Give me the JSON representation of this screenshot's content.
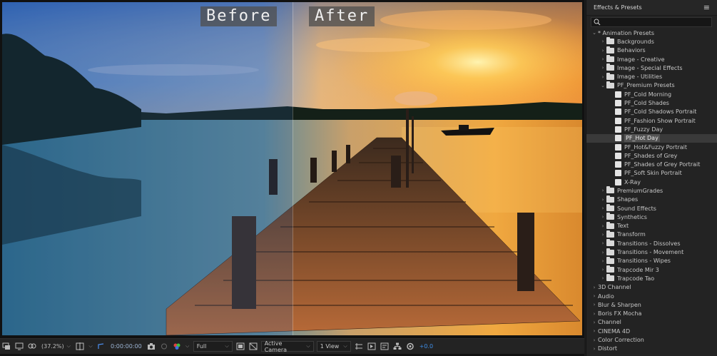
{
  "viewer": {
    "before_label": "Before",
    "after_label": "After"
  },
  "toolbar": {
    "zoom": "(37.2%)",
    "timecode": "0:00:00:00",
    "resolution": "Full",
    "camera": "Active Camera",
    "views": "1 View",
    "exposure": "+0.0",
    "colors": {
      "exposure": "#3e8ee8"
    }
  },
  "panel": {
    "title": "Effects & Presets",
    "menu_icon": "hamburger-menu-icon",
    "search_value": "",
    "items": [
      {
        "label": "* Animation Presets",
        "depth": 0,
        "type": "group",
        "open": true
      },
      {
        "label": "Backgrounds",
        "depth": 1,
        "type": "folder",
        "open": false
      },
      {
        "label": "Behaviors",
        "depth": 1,
        "type": "folder",
        "open": false
      },
      {
        "label": "Image - Creative",
        "depth": 1,
        "type": "folder",
        "open": false
      },
      {
        "label": "Image - Special Effects",
        "depth": 1,
        "type": "folder",
        "open": false
      },
      {
        "label": "Image - Utilities",
        "depth": 1,
        "type": "folder",
        "open": false
      },
      {
        "label": "PF_Premium Presets",
        "depth": 1,
        "type": "folder",
        "open": true
      },
      {
        "label": "PF_Cold Morning",
        "depth": 2,
        "type": "preset"
      },
      {
        "label": "PF_Cold Shades",
        "depth": 2,
        "type": "preset"
      },
      {
        "label": "PF_Cold Shadows Portrait",
        "depth": 2,
        "type": "preset"
      },
      {
        "label": "PF_Fashion Show Portrait",
        "depth": 2,
        "type": "preset"
      },
      {
        "label": "PF_Fuzzy Day",
        "depth": 2,
        "type": "preset"
      },
      {
        "label": "PF_Hot Day",
        "depth": 2,
        "type": "preset",
        "selected": true
      },
      {
        "label": "PF_Hot&Fuzzy Portrait",
        "depth": 2,
        "type": "preset"
      },
      {
        "label": "PF_Shades of Grey",
        "depth": 2,
        "type": "preset"
      },
      {
        "label": "PF_Shades of Grey Portrait",
        "depth": 2,
        "type": "preset"
      },
      {
        "label": "PF_Soft Skin Portrait",
        "depth": 2,
        "type": "preset"
      },
      {
        "label": "X-Ray",
        "depth": 2,
        "type": "preset"
      },
      {
        "label": "PremiumGrades",
        "depth": 1,
        "type": "folder",
        "open": false
      },
      {
        "label": "Shapes",
        "depth": 1,
        "type": "folder",
        "open": false
      },
      {
        "label": "Sound Effects",
        "depth": 1,
        "type": "folder",
        "open": false
      },
      {
        "label": "Synthetics",
        "depth": 1,
        "type": "folder",
        "open": false
      },
      {
        "label": "Text",
        "depth": 1,
        "type": "folder",
        "open": false
      },
      {
        "label": "Transform",
        "depth": 1,
        "type": "folder",
        "open": false
      },
      {
        "label": "Transitions - Dissolves",
        "depth": 1,
        "type": "folder",
        "open": false
      },
      {
        "label": "Transitions - Movement",
        "depth": 1,
        "type": "folder",
        "open": false
      },
      {
        "label": "Transitions - Wipes",
        "depth": 1,
        "type": "folder",
        "open": false
      },
      {
        "label": "Trapcode Mir 3",
        "depth": 1,
        "type": "folder",
        "open": false
      },
      {
        "label": "Trapcode Tao",
        "depth": 1,
        "type": "folder",
        "open": false
      },
      {
        "label": "3D Channel",
        "depth": 0,
        "type": "group",
        "open": false
      },
      {
        "label": "Audio",
        "depth": 0,
        "type": "group",
        "open": false
      },
      {
        "label": "Blur & Sharpen",
        "depth": 0,
        "type": "group",
        "open": false
      },
      {
        "label": "Boris FX Mocha",
        "depth": 0,
        "type": "group",
        "open": false
      },
      {
        "label": "Channel",
        "depth": 0,
        "type": "group",
        "open": false
      },
      {
        "label": "CINEMA 4D",
        "depth": 0,
        "type": "group",
        "open": false
      },
      {
        "label": "Color Correction",
        "depth": 0,
        "type": "group",
        "open": false
      },
      {
        "label": "Distort",
        "depth": 0,
        "type": "group",
        "open": false
      }
    ]
  }
}
